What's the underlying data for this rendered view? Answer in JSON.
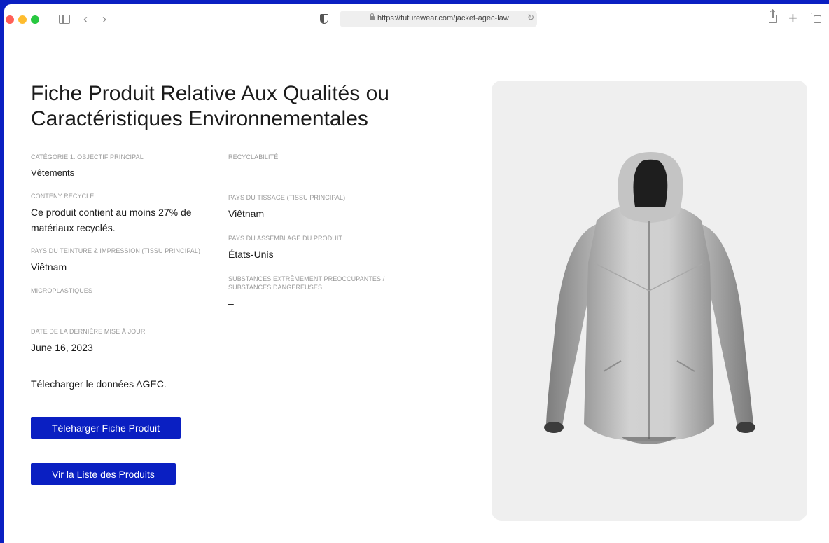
{
  "browser": {
    "url": "https://futurewear.com/jacket-agec-law"
  },
  "page": {
    "title": "Fiche Produit Relative Aux Qualités ou Caractéristiques Environnementales",
    "fields_left": [
      {
        "label": "CATÉGORIE 1: OBJECTIF PRINCIPAL",
        "value": "Vêtements"
      },
      {
        "label": "CONTENY RECYCLÉ",
        "value": "Ce produit contient au moins 27% de matériaux recyclés."
      },
      {
        "label": "PAYS DU TEINTURE & IMPRESSION (TISSU PRINCIPAL)",
        "value": "Viêtnam"
      },
      {
        "label": "MICROPLASTIQUES",
        "value": "–"
      },
      {
        "label": "DATE DE LA DERNIÈRE MISE À JOUR",
        "value": "June 16, 2023"
      }
    ],
    "fields_right": [
      {
        "label": "RECYCLABILITÉ",
        "value": "–"
      },
      {
        "label": "PAYS DU TISSAGE (TISSU PRINCIPAL)",
        "value": "Viêtnam"
      },
      {
        "label": "PAYS DU ASSEMBLAGE DU PRODUIT",
        "value": "États-Unis"
      },
      {
        "label": "SUBSTANCES EXTRÊMEMENT PREOCCUPANTES / SUBSTANCES DANGEREUSES",
        "value": "–"
      }
    ],
    "download_text": "Télecharger le données AGEC.",
    "button_download": "Téleharger Fiche Produit",
    "button_list": "Vir la Liste des Produits"
  }
}
